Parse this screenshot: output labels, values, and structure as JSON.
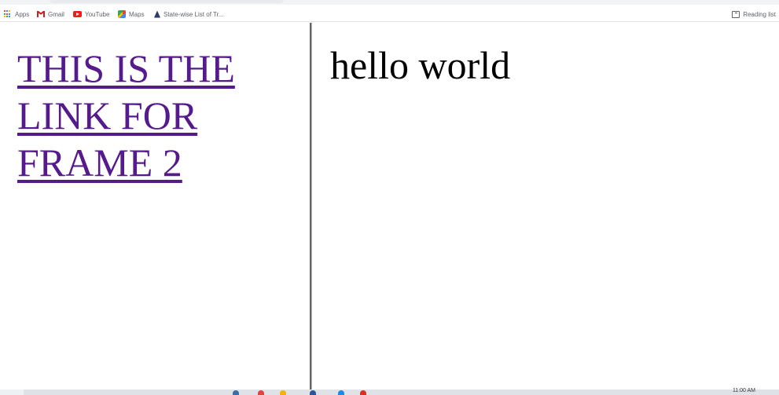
{
  "bookmarks": [
    {
      "label": "Apps",
      "icon": "apps-grid-icon"
    },
    {
      "label": "Gmail",
      "icon": "gmail-icon"
    },
    {
      "label": "YouTube",
      "icon": "youtube-icon"
    },
    {
      "label": "Maps",
      "icon": "maps-icon"
    },
    {
      "label": "State-wise List of Tr...",
      "icon": "site-icon"
    }
  ],
  "reading_list": {
    "label": "Reading list",
    "icon": "reading-list-icon"
  },
  "left_frame": {
    "link_text": "THIS IS THE LINK FOR FRAME 2"
  },
  "right_frame": {
    "text": "hello world"
  },
  "taskbar": {
    "clock": "11:00 AM"
  },
  "colors": {
    "link_visited": "#551a8b",
    "text": "#000000",
    "bookmark_text": "#5f6368",
    "youtube_red": "#e62117",
    "gmail_red": "#c5221f"
  }
}
